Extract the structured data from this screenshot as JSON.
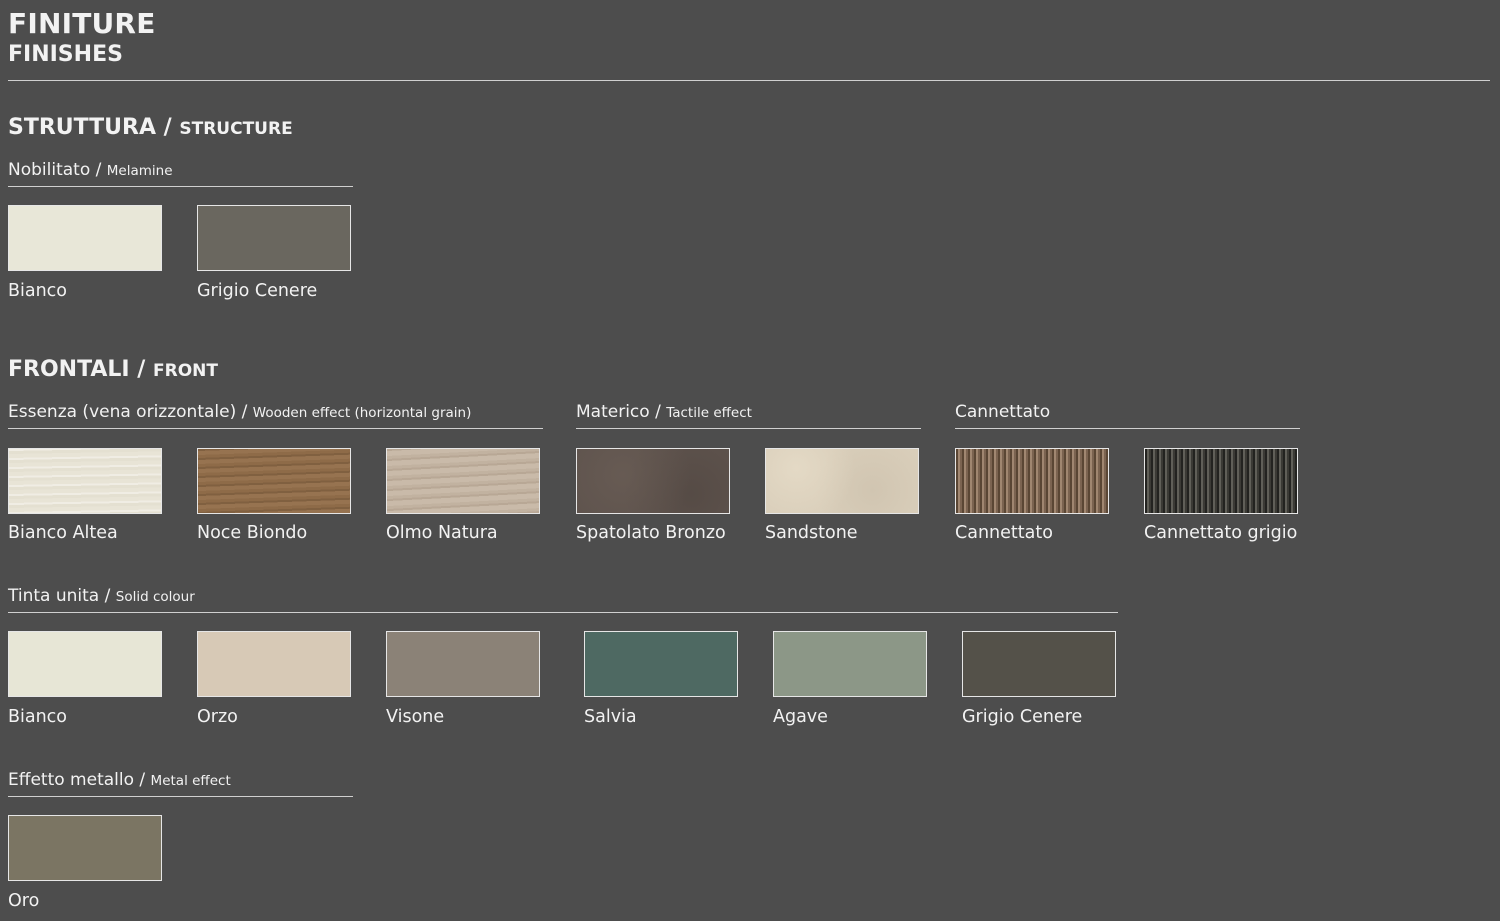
{
  "header": {
    "title": "FINITURE",
    "subtitle": "FINISHES"
  },
  "struttura": {
    "title_it": "STRUTTURA /",
    "title_en": "STRUCTURE",
    "groups": [
      {
        "label_it": "Nobilitato /",
        "label_en": "Melamine",
        "swatches": [
          {
            "name": "Bianco",
            "color": "#e8e7d8"
          },
          {
            "name": "Grigio Cenere",
            "color": "#6a675f"
          }
        ]
      }
    ]
  },
  "frontali": {
    "title_it": "FRONTALI /",
    "title_en": "FRONT",
    "essenza": {
      "label_it": "Essenza (vena orizzontale) /",
      "label_en": "Wooden effect (horizontal grain)",
      "swatches": [
        {
          "name": "Bianco Altea",
          "texture": "bianco-altea"
        },
        {
          "name": "Noce Biondo",
          "texture": "noce-biondo"
        },
        {
          "name": "Olmo Natura",
          "texture": "olmo-natura"
        }
      ]
    },
    "materico": {
      "label_it": "Materico /",
      "label_en": "Tactile effect",
      "swatches": [
        {
          "name": "Spatolato Bronzo",
          "texture": "spatolato"
        },
        {
          "name": "Sandstone",
          "texture": "sandstone"
        }
      ]
    },
    "cannettato": {
      "label_it": "Cannettato",
      "swatches": [
        {
          "name": "Cannettato",
          "texture": "cannettato"
        },
        {
          "name": "Cannettato grigio",
          "texture": "cannettato-grigio"
        }
      ]
    },
    "tinta_unita": {
      "label_it": "Tinta unita /",
      "label_en": "Solid colour",
      "swatches": [
        {
          "name": "Bianco",
          "color": "#e7e6d6"
        },
        {
          "name": "Orzo",
          "color": "#d7c9b6"
        },
        {
          "name": "Visone",
          "color": "#8b8277"
        },
        {
          "name": "Salvia",
          "color": "#4e6962"
        },
        {
          "name": "Agave",
          "color": "#8c9787"
        },
        {
          "name": "Grigio Cenere",
          "color": "#545149"
        }
      ]
    },
    "metallo": {
      "label_it": "Effetto metallo /",
      "label_en": "Metal effect",
      "swatches": [
        {
          "name": "Oro",
          "color": "#7b7563"
        }
      ]
    }
  }
}
